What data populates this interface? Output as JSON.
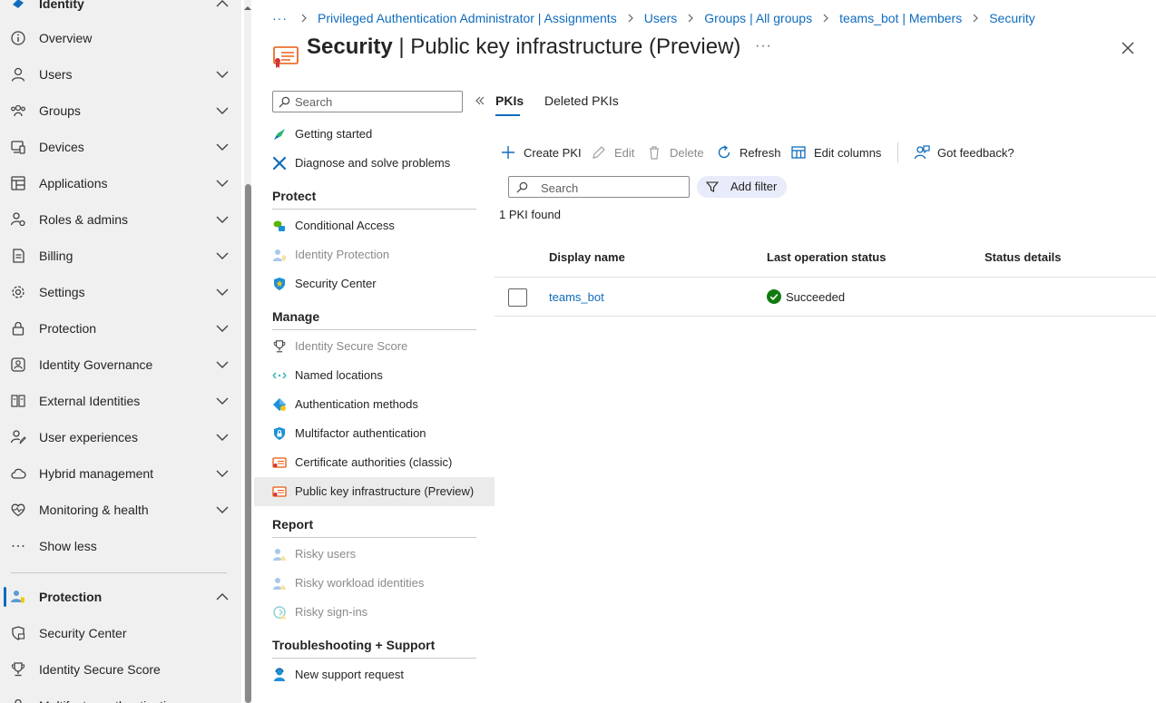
{
  "leftnav": {
    "top_item": "Identity",
    "items": [
      {
        "label": "Overview",
        "icon": "info-icon",
        "chevron": false
      },
      {
        "label": "Users",
        "icon": "user-icon",
        "chevron": true
      },
      {
        "label": "Groups",
        "icon": "groups-icon",
        "chevron": true
      },
      {
        "label": "Devices",
        "icon": "devices-icon",
        "chevron": true
      },
      {
        "label": "Applications",
        "icon": "applications-icon",
        "chevron": true
      },
      {
        "label": "Roles & admins",
        "icon": "roles-icon",
        "chevron": true
      },
      {
        "label": "Billing",
        "icon": "billing-icon",
        "chevron": true
      },
      {
        "label": "Settings",
        "icon": "gear-icon",
        "chevron": true
      },
      {
        "label": "Protection",
        "icon": "lock-icon",
        "chevron": true
      },
      {
        "label": "Identity Governance",
        "icon": "governance-icon",
        "chevron": true
      },
      {
        "label": "External Identities",
        "icon": "external-identities-icon",
        "chevron": true
      },
      {
        "label": "User experiences",
        "icon": "user-experiences-icon",
        "chevron": true
      },
      {
        "label": "Hybrid management",
        "icon": "cloud-icon",
        "chevron": true
      },
      {
        "label": "Monitoring & health",
        "icon": "heart-pulse-icon",
        "chevron": true
      },
      {
        "label": "Show less",
        "icon": "more-icon",
        "chevron": false
      }
    ],
    "section": {
      "label": "Protection",
      "icon": "protection-person-icon"
    },
    "section_items": [
      {
        "label": "Security Center",
        "icon": "shield-lock-icon"
      },
      {
        "label": "Identity Secure Score",
        "icon": "trophy-icon"
      },
      {
        "label": "Multifactor authentication",
        "icon": "mfa-icon"
      }
    ]
  },
  "breadcrumb": {
    "more": "···",
    "items": [
      "Privileged Authentication Administrator | Assignments",
      "Users",
      "Groups | All groups",
      "teams_bot | Members",
      "Security"
    ]
  },
  "header": {
    "title_strong": "Security",
    "title_rest": " | Public key infrastructure (Preview)",
    "more": "···"
  },
  "menu": {
    "search_placeholder": "Search",
    "top_items": [
      {
        "label": "Getting started",
        "icon": "rocket-icon",
        "disabled": false
      },
      {
        "label": "Diagnose and solve problems",
        "icon": "wrench-icon",
        "disabled": false
      }
    ],
    "sections": [
      {
        "title": "Protect",
        "items": [
          {
            "label": "Conditional Access",
            "icon": "conditional-access-icon",
            "disabled": false
          },
          {
            "label": "Identity Protection",
            "icon": "identity-protection-icon",
            "disabled": true
          },
          {
            "label": "Security Center",
            "icon": "security-center-icon",
            "disabled": false
          }
        ]
      },
      {
        "title": "Manage",
        "items": [
          {
            "label": "Identity Secure Score",
            "icon": "trophy-icon",
            "disabled": true
          },
          {
            "label": "Named locations",
            "icon": "named-locations-icon",
            "disabled": false
          },
          {
            "label": "Authentication methods",
            "icon": "authentication-methods-icon",
            "disabled": false
          },
          {
            "label": "Multifactor authentication",
            "icon": "mfa-lock-icon",
            "disabled": false
          },
          {
            "label": "Certificate authorities (classic)",
            "icon": "certificate-icon",
            "disabled": false
          },
          {
            "label": "Public key infrastructure (Preview)",
            "icon": "certificate-icon",
            "disabled": false,
            "active": true
          }
        ]
      },
      {
        "title": "Report",
        "items": [
          {
            "label": "Risky users",
            "icon": "risky-users-icon",
            "disabled": true
          },
          {
            "label": "Risky workload identities",
            "icon": "risky-workload-icon",
            "disabled": true
          },
          {
            "label": "Risky sign-ins",
            "icon": "risky-signins-icon",
            "disabled": true
          }
        ]
      },
      {
        "title": "Troubleshooting + Support",
        "items": [
          {
            "label": "New support request",
            "icon": "support-request-icon",
            "disabled": false
          }
        ]
      }
    ]
  },
  "tabs": [
    {
      "label": "PKIs",
      "active": true
    },
    {
      "label": "Deleted PKIs",
      "active": false
    }
  ],
  "toolbar": {
    "create": "Create PKI",
    "edit": "Edit",
    "delete": "Delete",
    "refresh": "Refresh",
    "edit_columns": "Edit columns",
    "feedback": "Got feedback?"
  },
  "filter": {
    "search_placeholder": "Search",
    "add_filter": "Add filter",
    "result_count": "1 PKI found"
  },
  "table": {
    "columns": [
      "Display name",
      "Last operation status",
      "Status details"
    ],
    "rows": [
      {
        "display_name": "teams_bot",
        "status": "Succeeded",
        "details": ""
      }
    ]
  },
  "colors": {
    "accent": "#0f6cbd",
    "success": "#107c10",
    "nav_bg": "#f0f0f0",
    "certificate": "#e8590c"
  }
}
